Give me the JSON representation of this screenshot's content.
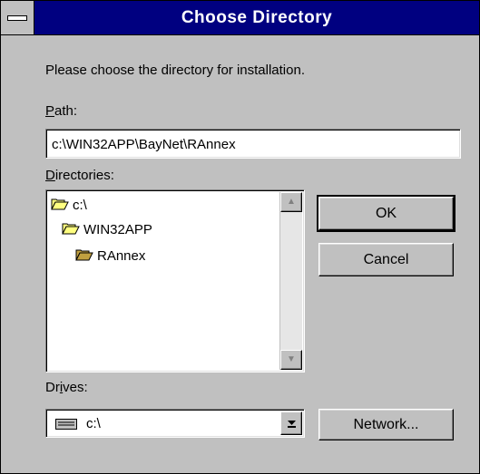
{
  "window": {
    "title": "Choose Directory"
  },
  "prompt": "Please choose the directory for installation.",
  "path": {
    "label": "Path:",
    "value": "c:\\WIN32APP\\BayNet\\RAnnex"
  },
  "directories": {
    "label": "Directories:",
    "items": [
      {
        "label": "c:\\",
        "icon": "open-folder-icon"
      },
      {
        "label": "WIN32APP",
        "icon": "open-folder-icon"
      },
      {
        "label": "RAnnex",
        "icon": "open-folder-icon"
      }
    ]
  },
  "drives": {
    "label": "Drives:",
    "selected": "c:\\",
    "icon": "drive-icon"
  },
  "buttons": {
    "ok": "OK",
    "cancel": "Cancel",
    "network": "Network..."
  }
}
